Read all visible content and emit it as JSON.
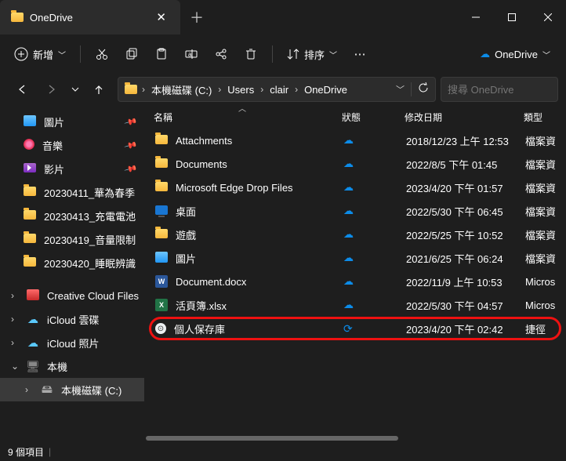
{
  "title": "OneDrive",
  "toolbar": {
    "new": "新增",
    "sort": "排序",
    "onedrive_btn": "OneDrive"
  },
  "breadcrumb": [
    "本機磁碟 (C:)",
    "Users",
    "clair",
    "OneDrive"
  ],
  "search_placeholder": "搜尋 OneDrive",
  "sidebar": {
    "quick": [
      {
        "label": "圖片",
        "icon": "image",
        "pinned": true
      },
      {
        "label": "音樂",
        "icon": "music",
        "pinned": true
      },
      {
        "label": "影片",
        "icon": "video",
        "pinned": true
      },
      {
        "label": "20230411_華為春季",
        "icon": "folder"
      },
      {
        "label": "20230413_充電電池",
        "icon": "folder"
      },
      {
        "label": "20230419_音量限制",
        "icon": "folder"
      },
      {
        "label": "20230420_睡眠辨識",
        "icon": "folder"
      }
    ],
    "collapsed": [
      {
        "label": "Creative Cloud Files",
        "icon": "cc",
        "chev": true
      },
      {
        "label": "iCloud 雲碟",
        "icon": "icloud",
        "chev": true
      },
      {
        "label": "iCloud 照片",
        "icon": "icloud",
        "chev": true
      }
    ],
    "pc": {
      "label": "本機"
    },
    "drive": {
      "label": "本機磁碟 (C:)"
    }
  },
  "columns": {
    "name": "名稱",
    "status": "狀態",
    "date": "修改日期",
    "type": "類型"
  },
  "files": [
    {
      "name": "Attachments",
      "icon": "folder",
      "status": "cloud",
      "date": "2018/12/23 上午 12:53",
      "type": "檔案資"
    },
    {
      "name": "Documents",
      "icon": "folder",
      "status": "cloud",
      "date": "2022/8/5 下午 01:45",
      "type": "檔案資"
    },
    {
      "name": "Microsoft Edge Drop Files",
      "icon": "folder",
      "status": "cloud",
      "date": "2023/4/20 下午 01:57",
      "type": "檔案資"
    },
    {
      "name": "桌面",
      "icon": "desktop",
      "status": "cloud",
      "date": "2022/5/30 下午 06:45",
      "type": "檔案資"
    },
    {
      "name": "遊戲",
      "icon": "folder",
      "status": "cloud",
      "date": "2022/5/25 下午 10:52",
      "type": "檔案資"
    },
    {
      "name": "圖片",
      "icon": "image",
      "status": "cloud",
      "date": "2021/6/25 下午 06:24",
      "type": "檔案資"
    },
    {
      "name": "Document.docx",
      "icon": "word",
      "status": "cloud",
      "date": "2022/11/9 上午 10:53",
      "type": "Micros"
    },
    {
      "name": "活頁簿.xlsx",
      "icon": "excel",
      "status": "cloud",
      "date": "2022/5/30 下午 04:57",
      "type": "Micros"
    },
    {
      "name": "個人保存庫",
      "icon": "vault",
      "status": "sync",
      "date": "2023/4/20 下午 02:42",
      "type": "捷徑",
      "highlight": true
    }
  ],
  "statusbar": {
    "count": "9 個項目"
  }
}
